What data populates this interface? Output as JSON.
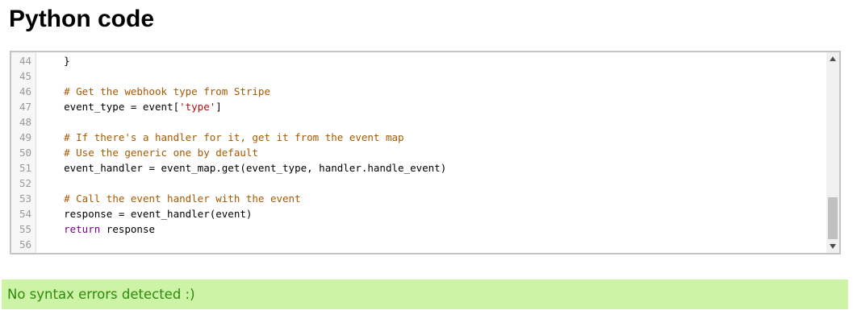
{
  "page": {
    "title": "Python code"
  },
  "editor": {
    "language": "python",
    "lines": [
      {
        "number": "44",
        "tokens": [
          {
            "type": "plain",
            "text": "    }"
          }
        ]
      },
      {
        "number": "45",
        "tokens": []
      },
      {
        "number": "46",
        "tokens": [
          {
            "type": "plain",
            "text": "    "
          },
          {
            "type": "comment",
            "text": "# Get the webhook type from Stripe"
          }
        ]
      },
      {
        "number": "47",
        "tokens": [
          {
            "type": "plain",
            "text": "    event_type = event["
          },
          {
            "type": "string",
            "text": "'type'"
          },
          {
            "type": "plain",
            "text": "]"
          }
        ]
      },
      {
        "number": "48",
        "tokens": []
      },
      {
        "number": "49",
        "tokens": [
          {
            "type": "plain",
            "text": "    "
          },
          {
            "type": "comment",
            "text": "# If there's a handler for it, get it from the event map"
          }
        ]
      },
      {
        "number": "50",
        "tokens": [
          {
            "type": "plain",
            "text": "    "
          },
          {
            "type": "comment",
            "text": "# Use the generic one by default"
          }
        ]
      },
      {
        "number": "51",
        "tokens": [
          {
            "type": "plain",
            "text": "    event_handler = event_map.get(event_type, handler.handle_event)"
          }
        ]
      },
      {
        "number": "52",
        "tokens": []
      },
      {
        "number": "53",
        "tokens": [
          {
            "type": "plain",
            "text": "    "
          },
          {
            "type": "comment",
            "text": "# Call the event handler with the event"
          }
        ]
      },
      {
        "number": "54",
        "tokens": [
          {
            "type": "plain",
            "text": "    response = event_handler(event)"
          }
        ]
      },
      {
        "number": "55",
        "tokens": [
          {
            "type": "plain",
            "text": "    "
          },
          {
            "type": "keyword",
            "text": "return"
          },
          {
            "type": "plain",
            "text": " response"
          }
        ]
      },
      {
        "number": "56",
        "tokens": []
      }
    ],
    "scrollbar": {
      "up_icon": "triangle-up-icon",
      "down_icon": "triangle-down-icon",
      "scroll_position": 0.9
    }
  },
  "status": {
    "message": "No syntax errors detected :)",
    "background_color": "#cdf3a6",
    "text_color": "#2d8b0c"
  }
}
